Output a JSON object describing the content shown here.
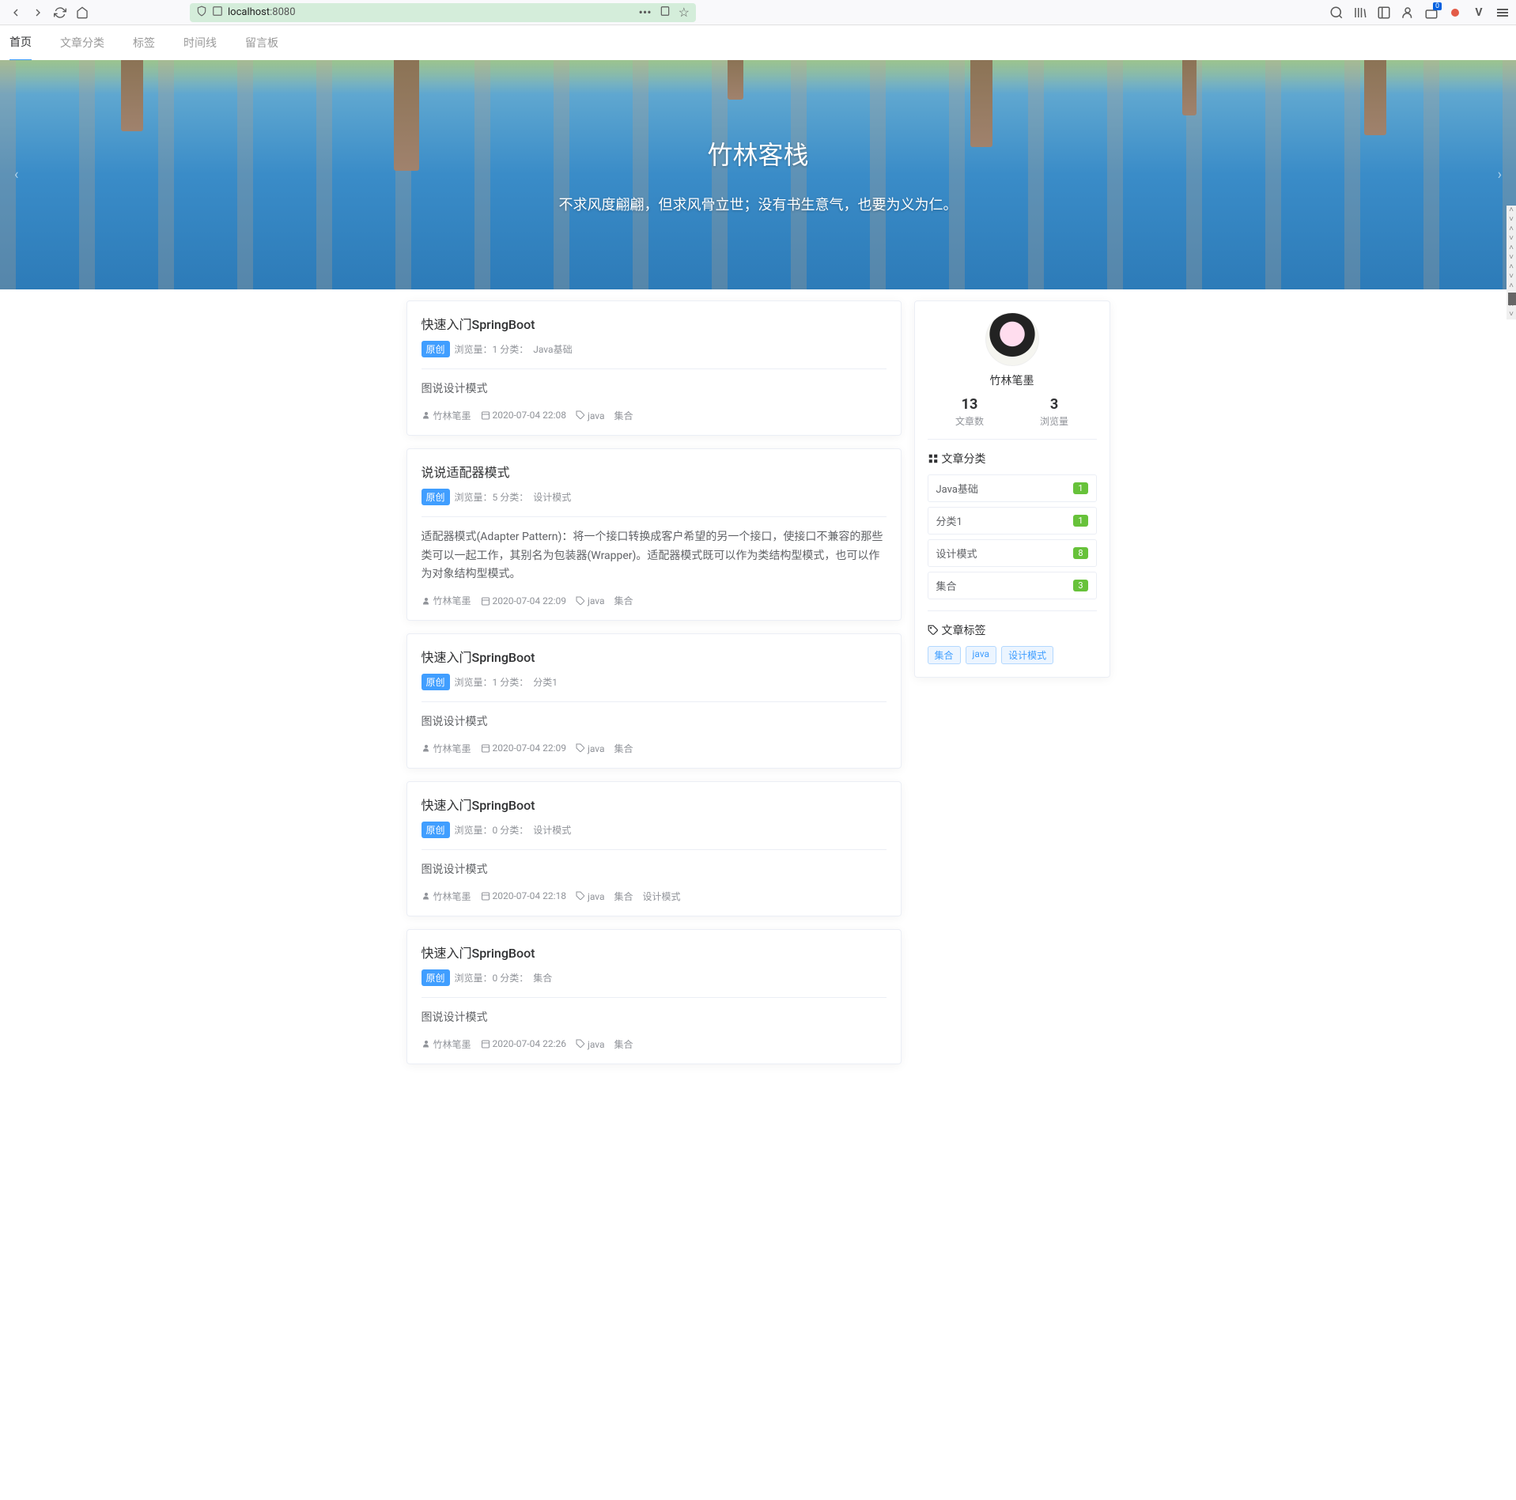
{
  "browser": {
    "url_host": "localhost",
    "url_port": ":8080",
    "notif_badge": "0"
  },
  "nav": {
    "items": [
      "首页",
      "文章分类",
      "标签",
      "时间线",
      "留言板"
    ],
    "active_index": 0
  },
  "hero": {
    "title": "竹林客栈",
    "subtitle": "不求风度翩翩，但求风骨立世；没有书生意气，也要为义为仁。"
  },
  "labels": {
    "badge_original": "原创",
    "views_prefix": "浏览量：",
    "category_prefix": "分类：",
    "aside_cat": "文章分类",
    "aside_tag": "文章标签"
  },
  "articles": [
    {
      "title": "快速入门SpringBoot",
      "views": "1",
      "category": "Java基础",
      "excerpt": "图说设计模式",
      "author": "竹林笔墨",
      "date": "2020-07-04 22:08",
      "tags": [
        "java",
        "集合"
      ]
    },
    {
      "title": "说说适配器模式",
      "views": "5",
      "category": "设计模式",
      "excerpt": "适配器模式(Adapter Pattern)：将一个接口转换成客户希望的另一个接口，使接口不兼容的那些类可以一起工作，其别名为包装器(Wrapper)。适配器模式既可以作为类结构型模式，也可以作为对象结构型模式。",
      "author": "竹林笔墨",
      "date": "2020-07-04 22:09",
      "tags": [
        "java",
        "集合"
      ]
    },
    {
      "title": "快速入门SpringBoot",
      "views": "1",
      "category": "分类1",
      "excerpt": "图说设计模式",
      "author": "竹林笔墨",
      "date": "2020-07-04 22:09",
      "tags": [
        "java",
        "集合"
      ]
    },
    {
      "title": "快速入门SpringBoot",
      "views": "0",
      "category": "设计模式",
      "excerpt": "图说设计模式",
      "author": "竹林笔墨",
      "date": "2020-07-04 22:18",
      "tags": [
        "java",
        "集合",
        "设计模式"
      ]
    },
    {
      "title": "快速入门SpringBoot",
      "views": "0",
      "category": "集合",
      "excerpt": "图说设计模式",
      "author": "竹林笔墨",
      "date": "2020-07-04 22:26",
      "tags": [
        "java",
        "集合"
      ]
    }
  ],
  "profile": {
    "name": "竹林笔墨",
    "stats": [
      {
        "n": "13",
        "l": "文章数"
      },
      {
        "n": "3",
        "l": "浏览量"
      }
    ]
  },
  "categories": [
    {
      "name": "Java基础",
      "count": "1"
    },
    {
      "name": "分类1",
      "count": "1"
    },
    {
      "name": "设计模式",
      "count": "8"
    },
    {
      "name": "集合",
      "count": "3"
    }
  ],
  "tags": [
    "集合",
    "java",
    "设计模式"
  ]
}
